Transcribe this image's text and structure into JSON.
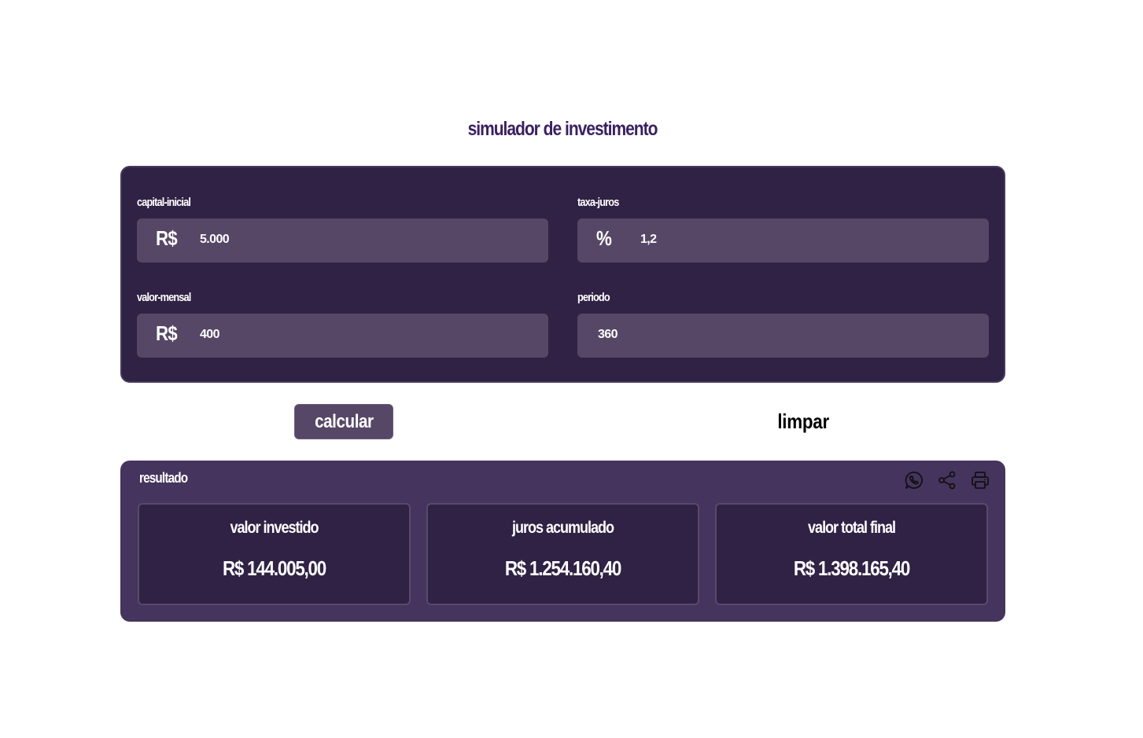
{
  "page": {
    "title": "simulador de investimento"
  },
  "form": {
    "capital_inicial": {
      "label": "capital-inicial",
      "prefix": "R$",
      "value": "5.000"
    },
    "taxa_juros": {
      "label": "taxa-juros",
      "prefix": "%",
      "value": "1,2"
    },
    "valor_mensal": {
      "label": "valor-mensal",
      "prefix": "R$",
      "value": "400"
    },
    "periodo": {
      "label": "periodo",
      "value": "360"
    }
  },
  "actions": {
    "calculate_label": "calcular",
    "clear_label": "limpar"
  },
  "result": {
    "title": "resultado",
    "cards": [
      {
        "label": "valor investido",
        "value": "R$ 144.005,00"
      },
      {
        "label": "juros acumulado",
        "value": "R$ 1.254.160,40"
      },
      {
        "label": "valor total final",
        "value": "R$ 1.398.165,40"
      }
    ],
    "icons": [
      "whatsapp-icon",
      "share-icon",
      "print-icon"
    ]
  },
  "colors": {
    "title": "#3b2160",
    "form_panel": "#302244",
    "field_box": "#564766",
    "result_panel": "#45345d",
    "card": "#302244"
  }
}
